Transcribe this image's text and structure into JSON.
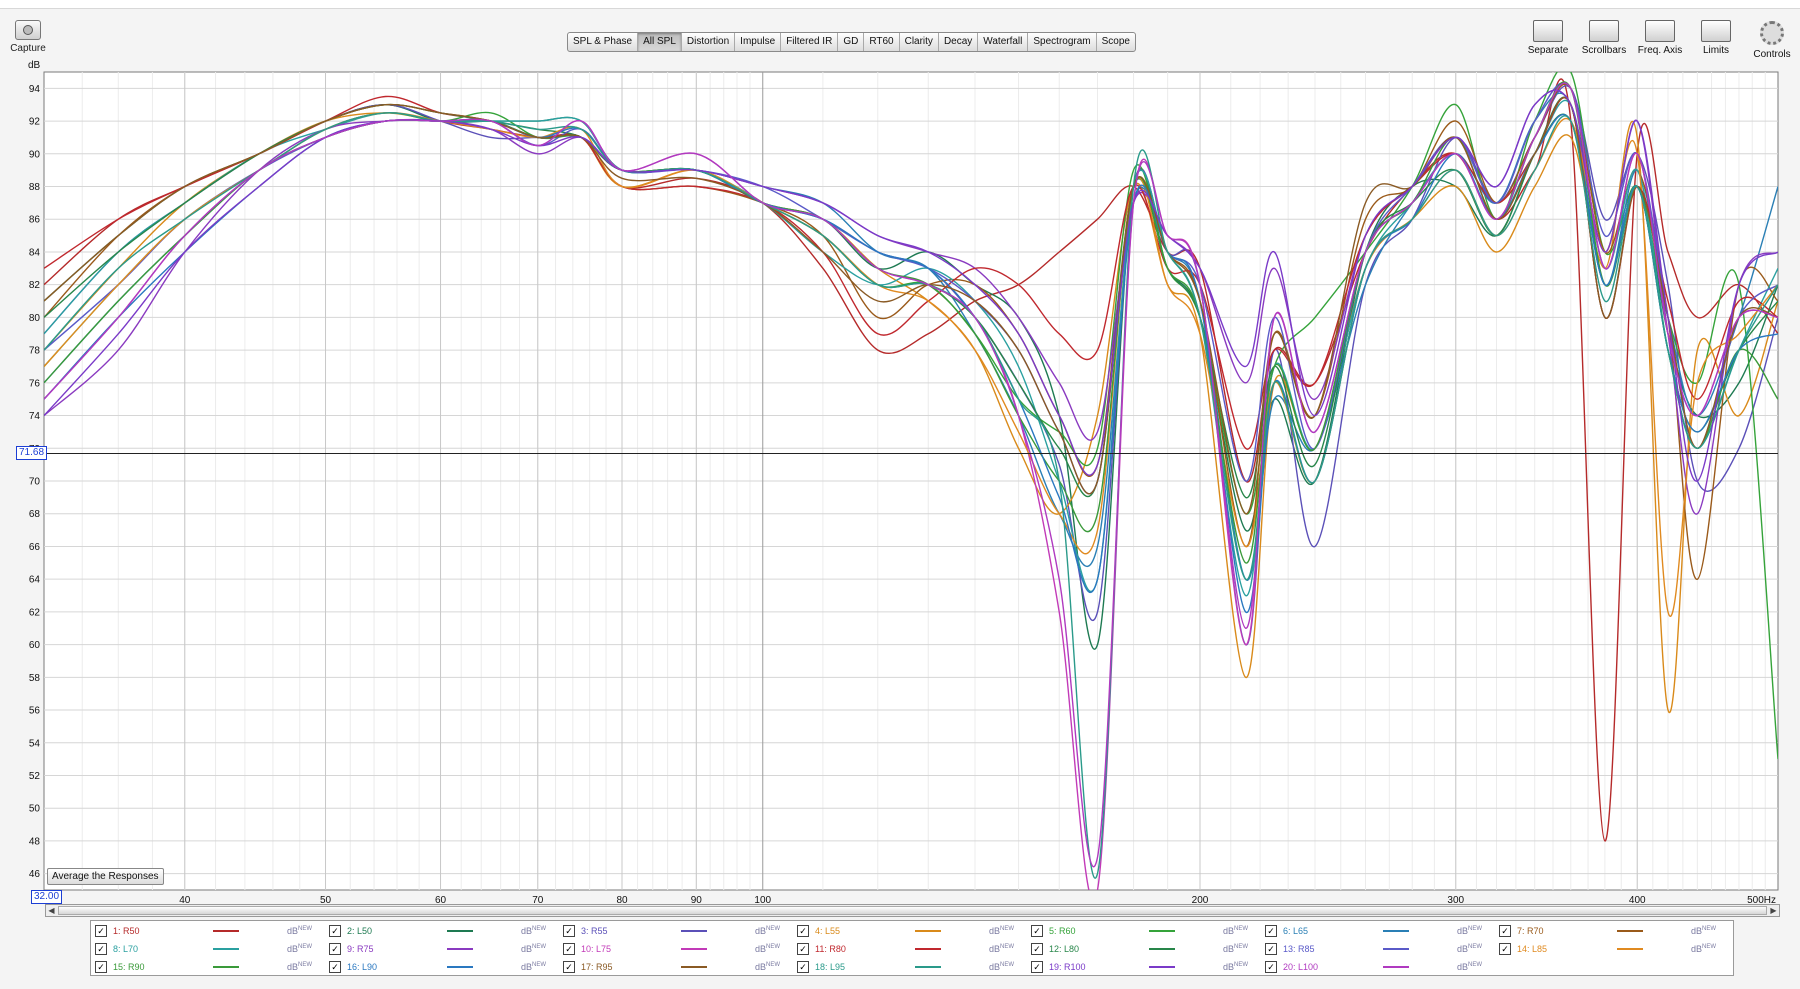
{
  "toolbar": {
    "capture_label": "Capture",
    "tabs": [
      "SPL & Phase",
      "All SPL",
      "Distortion",
      "Impulse",
      "Filtered IR",
      "GD",
      "RT60",
      "Clarity",
      "Decay",
      "Waterfall",
      "Spectrogram",
      "Scope"
    ],
    "active_tab": "All SPL",
    "right_tools": [
      "Separate",
      "Scrollbars",
      "Freq. Axis",
      "Limits",
      "Controls"
    ]
  },
  "cursor": {
    "y_value": "71.68",
    "x_start": "32.00"
  },
  "buttons": {
    "average": "Average the Responses"
  },
  "chart_data": {
    "type": "line",
    "ylabel": "dB",
    "xunit": "Hz",
    "xscale": "log",
    "xlim": [
      32,
      500
    ],
    "ylim": [
      45,
      95
    ],
    "xticks": [
      40,
      50,
      60,
      70,
      80,
      90,
      100,
      200,
      300,
      400
    ],
    "xtick_labels": [
      "40",
      "50",
      "60",
      "70",
      "80",
      "90",
      "100",
      "200",
      "300",
      "400"
    ],
    "xend_label": "500Hz",
    "yticks": [
      46,
      48,
      50,
      52,
      54,
      56,
      58,
      60,
      62,
      64,
      66,
      68,
      70,
      72,
      74,
      76,
      78,
      80,
      82,
      84,
      86,
      88,
      90,
      92,
      94
    ],
    "cursor_db": 71.68,
    "grid": true,
    "x": [
      32,
      36,
      40,
      45,
      50,
      55,
      60,
      65,
      70,
      75,
      80,
      90,
      100,
      110,
      120,
      130,
      140,
      150,
      160,
      170,
      180,
      190,
      200,
      215,
      225,
      240,
      260,
      280,
      300,
      320,
      340,
      360,
      380,
      400,
      420,
      440,
      470,
      500
    ],
    "series": [
      {
        "name": "1: R50",
        "color": "#b52a2a",
        "values": [
          82,
          86,
          88,
          90,
          92,
          93,
          92,
          91.5,
          91,
          91,
          88,
          88.5,
          87,
          83,
          78,
          79,
          81,
          82,
          84,
          86,
          88,
          84,
          83,
          70,
          78,
          76,
          84,
          88,
          90,
          86,
          89,
          92,
          48,
          90,
          84,
          80,
          82,
          79
        ]
      },
      {
        "name": "2: L50",
        "color": "#1e7a52",
        "values": [
          81,
          85,
          88,
          90,
          92,
          93,
          92,
          92,
          92,
          92,
          89,
          89,
          87,
          86,
          83,
          84,
          82,
          80,
          74,
          60,
          88,
          83,
          80,
          67,
          75,
          70,
          84,
          88,
          88,
          85,
          90,
          93,
          80,
          88,
          79,
          74,
          76,
          82
        ]
      },
      {
        "name": "3: R55",
        "color": "#5b50b8",
        "values": [
          79,
          84,
          87,
          90,
          92,
          93,
          92,
          91,
          91,
          91,
          89,
          89,
          87,
          86,
          84,
          83,
          80,
          76,
          71,
          62,
          88,
          84,
          82,
          60,
          78,
          66,
          82,
          86,
          91,
          87,
          91,
          94,
          86,
          90,
          82,
          70,
          72,
          80
        ]
      },
      {
        "name": "4: L55",
        "color": "#d98a1a",
        "values": [
          78,
          83,
          87,
          90,
          92,
          92.5,
          92,
          92,
          91,
          91,
          88,
          89,
          87,
          86,
          83,
          81,
          78,
          72,
          68,
          74,
          88,
          82,
          79,
          58,
          76,
          72,
          83,
          86,
          88,
          84,
          88,
          91,
          83,
          91,
          56,
          78,
          74,
          81
        ]
      },
      {
        "name": "5: R60",
        "color": "#35a33a",
        "values": [
          77,
          82,
          86,
          89,
          91.5,
          92.5,
          92,
          92.5,
          91,
          91,
          89,
          89,
          87,
          85,
          82,
          82,
          79,
          75,
          73,
          72,
          89,
          83,
          80,
          68,
          77,
          80,
          84,
          88,
          93,
          86,
          92,
          95,
          84,
          88,
          80,
          76,
          82,
          53
        ]
      },
      {
        "name": "6: L65",
        "color": "#2a7fb5",
        "values": [
          76,
          81,
          85,
          89,
          91,
          92,
          92,
          92,
          91,
          91,
          89,
          89,
          88,
          87,
          84,
          83,
          79,
          74,
          68,
          66,
          87,
          84,
          81,
          64,
          75,
          72,
          82,
          87,
          90,
          87,
          92,
          93,
          82,
          89,
          80,
          74,
          80,
          88
        ]
      },
      {
        "name": "7: R70",
        "color": "#9a5a1a",
        "values": [
          80,
          85,
          88,
          90,
          92,
          93,
          92.5,
          92,
          91,
          91,
          88,
          88,
          87,
          85,
          80,
          82,
          82,
          79,
          74,
          71,
          88,
          84,
          81,
          66,
          79,
          74,
          86,
          88,
          92,
          87,
          91,
          94,
          84,
          89,
          80,
          64,
          82,
          81
        ]
      },
      {
        "name": "8: L70",
        "color": "#2aa0a0",
        "values": [
          79,
          84,
          87,
          90,
          91.5,
          92.5,
          92,
          92,
          92,
          92,
          89,
          89,
          87,
          84,
          82,
          83,
          81,
          77,
          70,
          64,
          88,
          84,
          80,
          63,
          77,
          72,
          83,
          87,
          90,
          86,
          90,
          93,
          83,
          89,
          78,
          72,
          78,
          83
        ]
      },
      {
        "name": "9: R75",
        "color": "#8a3ac0",
        "values": [
          74,
          78,
          84,
          89,
          91.5,
          92,
          92,
          91.5,
          90,
          91,
          89,
          89,
          88,
          87,
          85,
          84,
          83,
          80,
          76,
          73,
          87,
          85,
          83,
          76,
          83,
          75,
          85,
          88,
          91,
          88,
          93,
          93,
          84,
          92,
          79,
          68,
          82,
          84
        ]
      },
      {
        "name": "10: L75",
        "color": "#c23ab8",
        "values": [
          75,
          80,
          85,
          89,
          91,
          92,
          92,
          92,
          90.5,
          92,
          89,
          90,
          87,
          86,
          83,
          82,
          80,
          74,
          62,
          45,
          87,
          85,
          82,
          60,
          80,
          73,
          84,
          87,
          90,
          86,
          91,
          94,
          83,
          90,
          79,
          74,
          80,
          80
        ]
      },
      {
        "name": "11: R80",
        "color": "#c0282e",
        "values": [
          83,
          86,
          88,
          90,
          92,
          93.5,
          92.5,
          92,
          91,
          91,
          88,
          88,
          87,
          84,
          79,
          81,
          83,
          82,
          79,
          78,
          88,
          83,
          82,
          72,
          78,
          76,
          85,
          88,
          90,
          87,
          90,
          93,
          80,
          88,
          81,
          75,
          81,
          80
        ]
      },
      {
        "name": "12: L80",
        "color": "#28864a",
        "values": [
          80,
          84,
          87,
          90,
          92,
          93,
          92.5,
          92,
          91.5,
          91,
          89,
          89,
          87,
          85,
          82,
          82,
          80,
          76,
          72,
          70,
          88,
          83,
          80,
          69,
          77,
          71,
          84,
          87,
          89,
          85,
          90,
          92,
          82,
          88,
          78,
          73,
          78,
          81
        ]
      },
      {
        "name": "13: R85",
        "color": "#5a5ac8",
        "values": [
          78,
          82,
          86,
          89,
          91,
          92,
          92,
          92,
          90.5,
          91.5,
          89,
          89,
          88,
          86,
          84,
          83,
          81,
          78,
          73,
          70,
          88,
          84,
          82,
          70,
          80,
          72,
          84,
          88,
          91,
          87,
          92,
          94,
          85,
          90,
          80,
          72,
          80,
          82
        ]
      },
      {
        "name": "14: L85",
        "color": "#e08a20",
        "values": [
          77,
          82,
          86,
          89,
          91.5,
          92.5,
          92,
          91.5,
          91,
          91.5,
          88,
          89,
          87,
          85,
          82,
          81,
          78,
          73,
          68,
          67,
          88,
          82,
          79,
          66,
          76,
          70,
          83,
          86,
          89,
          85,
          89,
          92,
          84,
          90,
          62,
          76,
          79,
          82
        ]
      },
      {
        "name": "15: R90",
        "color": "#3a9a3a",
        "values": [
          76,
          81,
          85,
          89,
          91,
          92,
          92,
          92,
          91,
          91,
          89,
          89,
          87,
          86,
          83,
          82,
          79,
          74,
          70,
          68,
          88,
          83,
          80,
          65,
          77,
          72,
          84,
          87,
          91,
          86,
          91,
          94,
          82,
          88,
          78,
          72,
          78,
          75
        ]
      },
      {
        "name": "16: L90",
        "color": "#2a78c0",
        "values": [
          75,
          80,
          84,
          88,
          91,
          92,
          92,
          92,
          91,
          91.5,
          89,
          89,
          87,
          86,
          84,
          83,
          80,
          75,
          69,
          64,
          87,
          84,
          81,
          62,
          76,
          70,
          83,
          86,
          90,
          86,
          90,
          92,
          82,
          88,
          78,
          73,
          78,
          79
        ]
      },
      {
        "name": "17: R95",
        "color": "#8a5a24",
        "values": [
          81,
          85,
          88,
          90,
          92,
          93,
          92.5,
          92,
          91,
          91,
          88.5,
          88.5,
          87,
          84,
          81,
          82,
          81,
          78,
          73,
          70,
          88,
          84,
          81,
          68,
          79,
          74,
          87,
          88,
          91,
          86,
          90,
          93,
          80,
          88,
          80,
          72,
          80,
          80
        ]
      },
      {
        "name": "18: L95",
        "color": "#2a9a8a",
        "values": [
          78,
          83,
          86,
          89,
          91.5,
          92.5,
          92,
          92,
          91.5,
          91.5,
          89,
          89,
          87,
          85,
          82,
          82,
          80,
          75,
          70,
          46,
          88,
          84,
          80,
          64,
          76,
          70,
          83,
          86,
          89,
          85,
          89,
          92,
          81,
          88,
          78,
          72,
          78,
          82
        ]
      },
      {
        "name": "19: R100",
        "color": "#7a3ac8",
        "values": [
          74,
          79,
          84,
          88,
          91,
          92,
          92,
          91.5,
          90.5,
          91,
          89,
          89,
          88,
          87,
          85,
          84,
          82,
          79,
          74,
          71,
          87,
          85,
          83,
          77,
          84,
          74,
          85,
          88,
          91,
          88,
          93,
          93,
          84,
          92,
          80,
          70,
          82,
          84
        ]
      },
      {
        "name": "20: L100",
        "color": "#b03ac0",
        "values": [
          75,
          80,
          85,
          89,
          91,
          92,
          92,
          92,
          90.5,
          92,
          89,
          90,
          87,
          86,
          83,
          82,
          80,
          74,
          64,
          47,
          87,
          85,
          82,
          61,
          80,
          73,
          84,
          87,
          90,
          86,
          91,
          94,
          83,
          90,
          79,
          74,
          80,
          80
        ]
      }
    ]
  },
  "legend": {
    "unit_label": "dB",
    "badge": "NEW"
  }
}
